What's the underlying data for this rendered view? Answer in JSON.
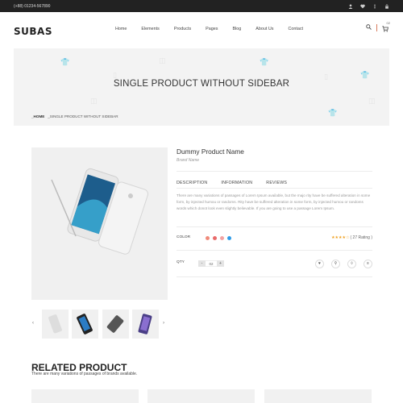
{
  "topbar": {
    "phone": "(+88) 01234-567890",
    "icons": [
      "user-icon",
      "heart-icon",
      "menu-icon",
      "lock-icon"
    ]
  },
  "header": {
    "logo": "SUBAS",
    "nav": [
      "Home",
      "Elements",
      "Products",
      "Pages",
      "Blog",
      "About Us",
      "Contact"
    ],
    "cart_count": "02"
  },
  "banner": {
    "title": "SINGLE PRODUCT WITHOUT SIDEBAR",
    "breadcrumb_home": "_HOME",
    "breadcrumb_current": "_SINGLE PRODUCT WITHOUT SIDEBAR"
  },
  "product": {
    "name": "Dummy Product Name",
    "brand": "Brand Name",
    "tabs": [
      "DESCRIPTION",
      "INFORMATION",
      "REVIEWS"
    ],
    "description": "There are many variations of passages of Lorem Ipsum available, but the majo rity have be suffered alteration in some form, by injected humou or randoms. Rity have be suffered alteration in some form, by injected humou or randoms words which donot look even slightly believable. If you are going to use a passage Lorem Ipsum.",
    "color_label": "COLOR",
    "swatches": [
      "#f08a7a",
      "#e96a6a",
      "#f2a3a3",
      "#2e9be8"
    ],
    "rating_stars": "★★★★☆",
    "rating_text": "( 27 Rating )",
    "qty_label": "QTY",
    "qty_minus": "-",
    "qty_value": "02",
    "qty_plus": "+"
  },
  "related": {
    "title": "RELATED PRODUCT",
    "subtitle": "There are many variations of passages of brands available."
  }
}
